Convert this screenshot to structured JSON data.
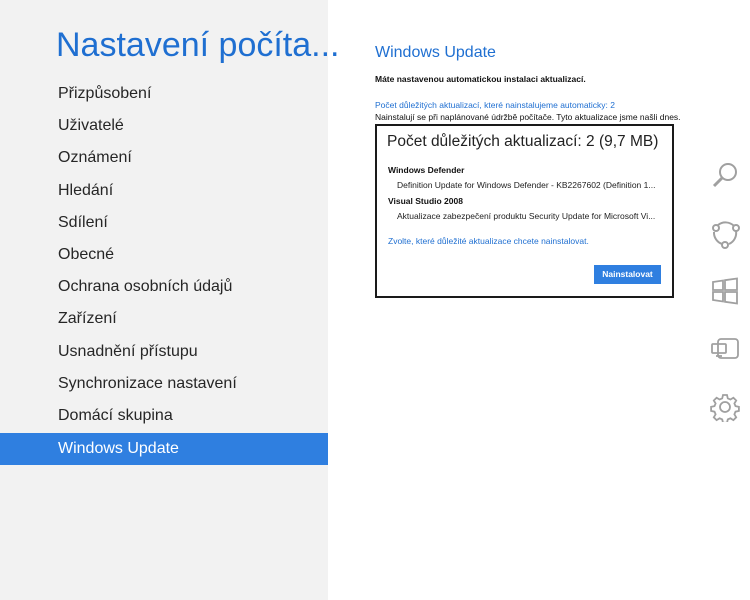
{
  "left_pane": {
    "title": "Nastavení počíta...",
    "nav_items": [
      {
        "label": "Přizpůsobení"
      },
      {
        "label": "Uživatelé"
      },
      {
        "label": "Oznámení"
      },
      {
        "label": "Hledání"
      },
      {
        "label": "Sdílení"
      },
      {
        "label": "Obecné"
      },
      {
        "label": "Ochrana osobních údajů"
      },
      {
        "label": "Zařízení"
      },
      {
        "label": "Usnadnění přístupu"
      },
      {
        "label": "Synchronizace nastavení"
      },
      {
        "label": "Domácí skupina"
      },
      {
        "label": "Windows Update"
      }
    ],
    "selected_index": 11
  },
  "content": {
    "title": "Windows Update",
    "status": "Máte nastavenou automatickou instalaci aktualizací.",
    "important_link": "Počet důležitých aktualizací, které nainstalujeme automaticky: 2",
    "info": "Nainstalují se při naplánované údržbě počítače. Tyto aktualizace jsme našli dnes."
  },
  "dialog": {
    "heading": "Počet důležitých aktualizací: 2 (9,7 MB)",
    "groups": [
      {
        "name": "Windows Defender",
        "item": "Definition Update for Windows Defender - KB2267602 (Definition 1..."
      },
      {
        "name": "Visual Studio 2008",
        "item": "Aktualizace zabezpečení produktu Security Update for Microsoft Vi..."
      }
    ],
    "choose_link": "Zvolte, které důležité aktualizace chcete nainstalovat.",
    "install_button": "Nainstalovat"
  },
  "charms": [
    {
      "icon": "search-icon"
    },
    {
      "icon": "share-icon"
    },
    {
      "icon": "windows-start-icon"
    },
    {
      "icon": "devices-icon"
    },
    {
      "icon": "settings-gear-icon"
    }
  ],
  "colors": {
    "accent": "#2f7fe0",
    "title_blue": "#1f6fd1",
    "left_background": "#f2f2f2",
    "charm_icon": "#a0a0a0"
  }
}
